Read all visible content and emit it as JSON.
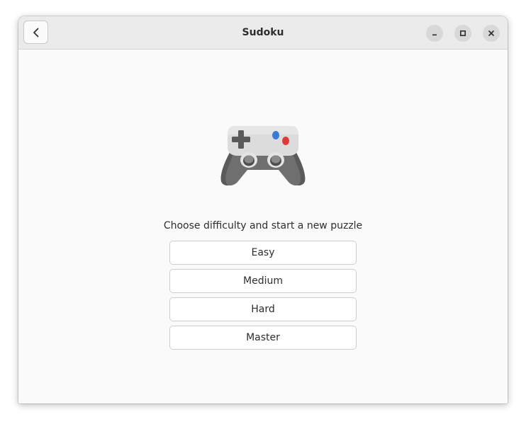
{
  "window": {
    "title": "Sudoku"
  },
  "headerbar": {
    "back_icon": "go-back-icon",
    "controls": {
      "minimize_icon": "minimize-icon",
      "maximize_icon": "maximize-icon",
      "close_icon": "close-icon"
    }
  },
  "main": {
    "illustration": "gamepad-icon",
    "prompt": "Choose difficulty and start a new puzzle",
    "difficulties": [
      {
        "label": "Easy"
      },
      {
        "label": "Medium"
      },
      {
        "label": "Hard"
      },
      {
        "label": "Master"
      }
    ]
  },
  "colors": {
    "headerbar_bg": "#ebebeb",
    "content_bg": "#fafafa",
    "button_border": "#cdcdcd",
    "text": "#2e2e2e"
  }
}
